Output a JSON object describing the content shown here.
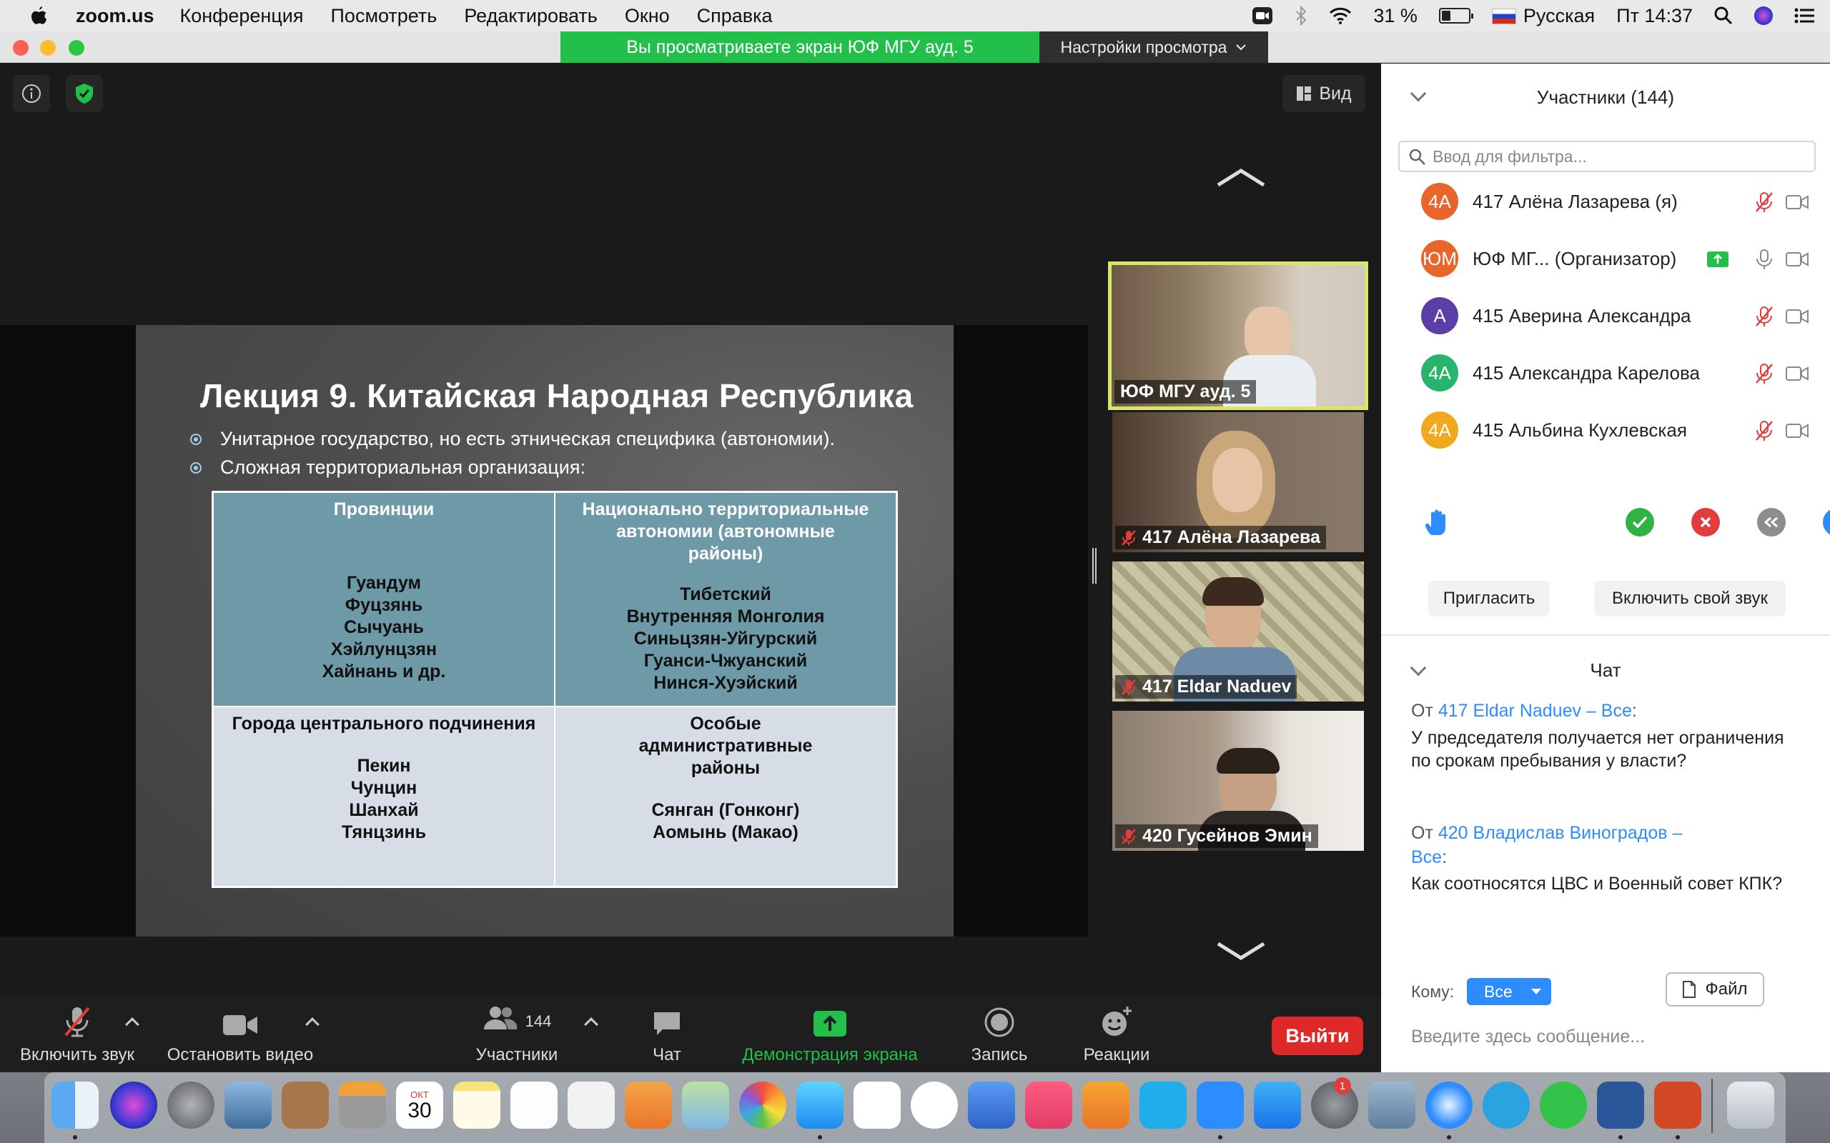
{
  "menubar": {
    "app_name": "zoom.us",
    "items": [
      "Конференция",
      "Посмотреть",
      "Редактировать",
      "Окно",
      "Справка"
    ],
    "battery": "31 %",
    "input_source": "Русская",
    "clock": "Пт 14:37"
  },
  "share_banner": {
    "text": "Вы просматриваете экран ЮФ МГУ ауд. 5",
    "view_options": "Настройки просмотра"
  },
  "view_button": "Вид",
  "slide": {
    "title": "Лекция 9. Китайская Народная Республика",
    "bullets": [
      "Унитарное государство, но есть этническая специфика (автономии).",
      "Сложная территориальная организация:"
    ],
    "table": {
      "provinces_header": "Провинции",
      "provinces": [
        "Гуандум",
        "Фуцзянь",
        "Сычуань",
        "Хэйлунцзян",
        "Хайнань и др."
      ],
      "autonomies_header": "Национально территориальные автономии (автономные районы)",
      "autonomies": [
        "Тибетский",
        "Внутренняя Монголия",
        "Синьцзян-Уйгурский",
        "Гуанси-Чжуанский",
        "Нинся-Хуэйский"
      ],
      "cities_header": "Города центрального подчинения",
      "cities": [
        "Пекин",
        "Чунцин",
        "Шанхай",
        "Тянцзинь"
      ],
      "sar_header": "Особые административные районы",
      "sar": [
        "Сянган (Гонконг)",
        "Аомынь (Макао)"
      ]
    }
  },
  "videos": [
    {
      "name": "ЮФ МГУ ауд. 5",
      "muted": false
    },
    {
      "name": "417 Алёна Лазарева",
      "muted": true
    },
    {
      "name": "417 Eldar Naduev",
      "muted": true
    },
    {
      "name": "420 Гусейнов Эмин",
      "muted": true
    }
  ],
  "toolbar": {
    "unmute": "Включить звук",
    "stop_video": "Остановить видео",
    "participants": "Участники",
    "participants_count": "144",
    "chat": "Чат",
    "share_screen": "Демонстрация экрана",
    "record": "Запись",
    "reactions": "Реакции",
    "leave": "Выйти"
  },
  "participants_panel": {
    "title": "Участники (144)",
    "filter_placeholder": "Ввод для фильтра...",
    "list": [
      {
        "initials": "4А",
        "name": "417 Алёна Лазарева (я)",
        "color": "#e8652b"
      },
      {
        "initials": "ЮМ",
        "name": "ЮФ МГ...   (Организатор)",
        "color": "#e8652b"
      },
      {
        "initials": "А",
        "name": "415 Аверина Александра",
        "color": "#5b3ea8"
      },
      {
        "initials": "4А",
        "name": "415 Александра Карелова",
        "color": "#27b56d"
      },
      {
        "initials": "4А",
        "name": "415 Альбина Кухлевская",
        "color": "#f2a81d"
      }
    ],
    "invite": "Пригласить",
    "unmute_self": "Включить свой звук"
  },
  "chat_panel": {
    "title": "Чат",
    "messages": [
      {
        "from_prefix": "От",
        "sender": "417 Eldar Naduev – Все",
        "suffix": ":",
        "text": "У председателя получается нет ограничения по срокам пребывания у власти?"
      },
      {
        "from_prefix": "От",
        "sender": "420 Владислав Виноградов – Все",
        "suffix": ":",
        "text": "Как соотносятся ЦВС и Военный совет КПК?"
      }
    ],
    "to_label": "Кому:",
    "to_value": "Все",
    "file_button": "Файл",
    "input_placeholder": "Введите здесь сообщение..."
  },
  "dock": {
    "calendar_month": "ОКТ",
    "calendar_day": "30",
    "badge": "1"
  },
  "colors": {
    "accent_green": "#22c04b",
    "leave_red": "#e02828",
    "link_blue": "#2d8cff",
    "slide_table_top": "#6e9aa8",
    "slide_table_bottom": "#d7dde6"
  }
}
